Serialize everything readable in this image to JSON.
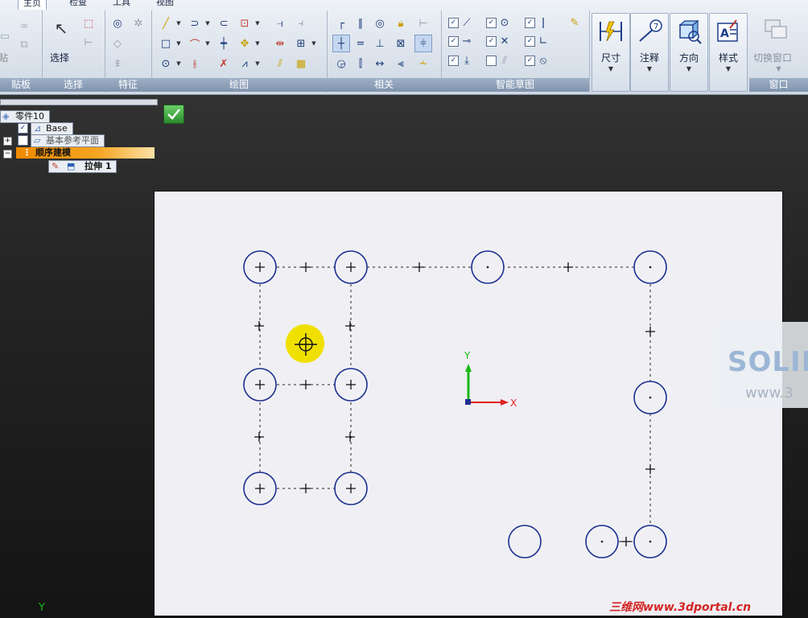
{
  "ribbon": {
    "tabs": [
      "主页",
      "检查",
      "工具",
      "视图"
    ],
    "groups": {
      "clipboard": "贴板",
      "select": "选择",
      "features": "特征",
      "draw": "绘图",
      "relate": "相关",
      "smart_sketch": "智能草图",
      "window": "窗口"
    },
    "buttons": {
      "paste": "贴",
      "select": "选择",
      "dimension": "尺寸",
      "annotation": "注释",
      "orientation": "方向",
      "style": "样式",
      "switch_window": "切换窗口"
    }
  },
  "tree": {
    "root": "零件10",
    "base": "Base",
    "ref_planes": "基本参考平面",
    "ordered": "顺序建模",
    "extrude": "拉伸 1"
  },
  "axes": {
    "y": "Y",
    "x": "X",
    "y_small": "Y"
  },
  "watermark": {
    "logo": "SOLID",
    "url": "www.3"
  },
  "footer": "三维网www.3dportal.cn",
  "colors": {
    "circle": "#1c2f8f",
    "highlight": "#f0e000",
    "axis_y": "#18b818",
    "axis_x": "#e02020",
    "accent_tree": "#f5a623"
  }
}
